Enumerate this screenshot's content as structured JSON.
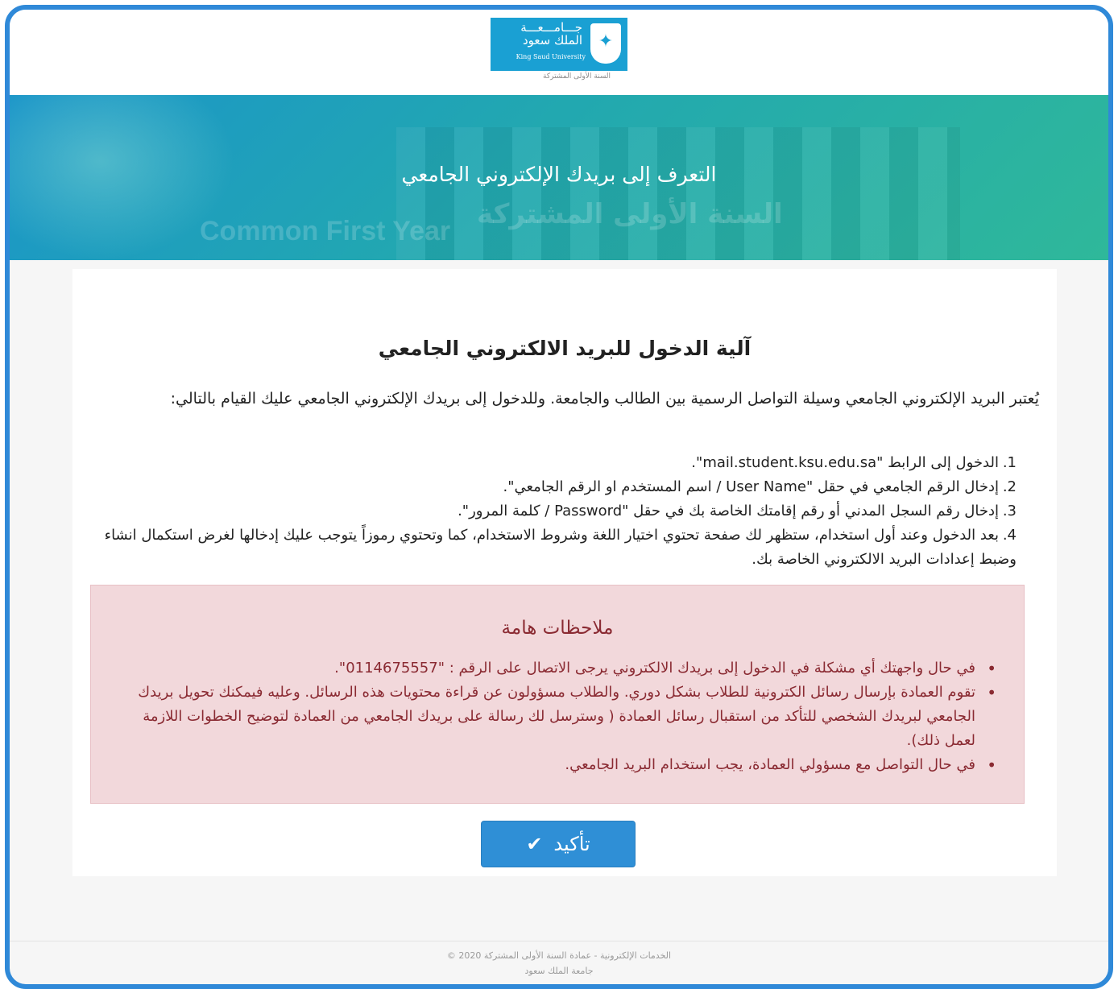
{
  "logo": {
    "ar_line1": "جـــامـــعـــة",
    "ar_line2": "الملك سعود",
    "en": "King Saud University",
    "sub": "السنة الأولى المشتركة"
  },
  "hero": {
    "title": "التعرف إلى بريدك الإلكتروني الجامعي",
    "watermark_en": "Common First Year",
    "watermark_ar": "السنة الأولى المشتركة"
  },
  "main": {
    "title": "آلية الدخول للبريد الالكتروني الجامعي",
    "intro": "يُعتبر البريد الإلكتروني الجامعي وسيلة التواصل الرسمية بين الطالب والجامعة. وللدخول إلى بريدك الإلكتروني الجامعي عليك القيام بالتالي:",
    "steps": [
      {
        "num": "1.",
        "text": "الدخول إلى الرابط \"mail.student.ksu.edu.sa\"."
      },
      {
        "num": "2.",
        "text": "إدخال الرقم الجامعي في حقل \"User Name / اسم المستخدم او الرقم الجامعي\"."
      },
      {
        "num": "3.",
        "text": "إدخال رقم السجل المدني أو رقم إقامتك الخاصة بك في حقل \"Password / كلمة المرور\"."
      },
      {
        "num": "4.",
        "text": "بعد الدخول وعند أول استخدام، ستظهر لك صفحة تحتوي اختيار اللغة وشروط الاستخدام، كما وتحتوي رموزاً يتوجب عليك إدخالها لغرض استكمال انشاء وضبط إعدادات البريد الالكتروني الخاصة بك."
      }
    ]
  },
  "notes": {
    "title": "ملاحظات هامة",
    "items": [
      "في حال واجهتك أي مشكلة في الدخول إلى بريدك الالكتروني يرجى الاتصال على الرقم : \"0114675557\".",
      "تقوم العمادة بإرسال رسائل الكترونية للطلاب بشكل دوري. والطلاب مسؤولون عن قراءة محتويات هذه الرسائل. وعليه فيمكنك تحويل بريدك الجامعي لبريدك الشخصي للتأكد من استقبال رسائل العمادة ( وسترسل لك رسالة على بريدك الجامعي من العمادة لتوضيح الخطوات اللازمة لعمل ذلك).",
      "في حال التواصل مع مسؤولي العمادة، يجب استخدام البريد الجامعي."
    ]
  },
  "button": {
    "label": "تأكيد",
    "icon": "check-icon"
  },
  "footer": {
    "line1": "© 2020 الخدمات الإلكترونية - عمادة السنة الأولى المشتركة",
    "line2": "جامعة الملك سعود"
  },
  "colors": {
    "frame_border": "#2f89d8",
    "hero_start": "#1b95c9",
    "hero_end": "#2fb89a",
    "notes_bg": "#f2d8db",
    "notes_text": "#8a2a32",
    "button_bg": "#2f8fd6"
  }
}
